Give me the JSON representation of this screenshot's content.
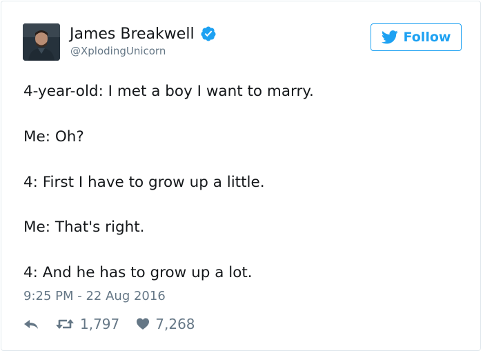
{
  "author": {
    "display_name": "James Breakwell",
    "handle": "@XplodingUnicorn",
    "verified_icon": "verified-badge-icon",
    "avatar_icon": "user-avatar"
  },
  "follow_button": {
    "label": "Follow",
    "icon": "twitter-bird-icon"
  },
  "tweet": {
    "lines": [
      "4-year-old: I met a boy I want to marry.",
      "Me: Oh?",
      "4: First I have to grow up a little.",
      "Me: That's right.",
      "4: And he has to grow up a lot."
    ],
    "timestamp": "9:25 PM - 22 Aug 2016"
  },
  "actions": {
    "reply_icon": "reply-icon",
    "retweet_icon": "retweet-icon",
    "retweet_count": "1,797",
    "like_icon": "heart-icon",
    "like_count": "7,268"
  },
  "colors": {
    "accent": "#1da1f2",
    "text_primary": "#14171a",
    "text_secondary": "#657786",
    "border": "#e1e8ed"
  }
}
